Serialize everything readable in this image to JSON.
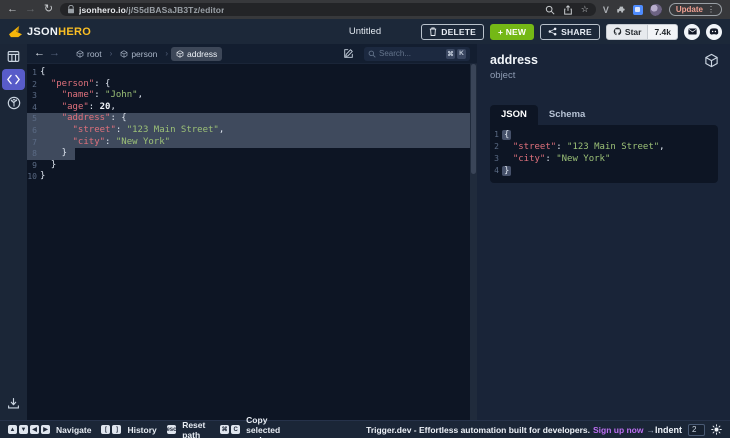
{
  "browser": {
    "url_domain": "jsonhero.io",
    "url_path": "/j/S5dBASaJB3Tz/editor",
    "update_label": "Update"
  },
  "header": {
    "logo_json": "JSON",
    "logo_hero": "HERO",
    "title": "Untitled",
    "delete_label": "DELETE",
    "new_label": "+ NEW",
    "share_label": "SHARE",
    "star_label": "Star",
    "star_count": "7.4k"
  },
  "toolbar": {
    "breadcrumb": [
      {
        "label": "root"
      },
      {
        "label": "person"
      },
      {
        "label": "address"
      }
    ],
    "search_placeholder": "Search...",
    "search_kbd": [
      "⌘",
      "K"
    ]
  },
  "editor": {
    "lines": [
      {
        "n": 1,
        "seg": [
          [
            "{",
            "p"
          ]
        ]
      },
      {
        "n": 2,
        "seg": [
          [
            "  ",
            "p"
          ],
          [
            "\"person\"",
            "k"
          ],
          [
            ": {",
            "p"
          ]
        ]
      },
      {
        "n": 3,
        "seg": [
          [
            "    ",
            "p"
          ],
          [
            "\"name\"",
            "k"
          ],
          [
            ": ",
            "p"
          ],
          [
            "\"John\"",
            "s"
          ],
          [
            ",",
            "p"
          ]
        ]
      },
      {
        "n": 4,
        "seg": [
          [
            "    ",
            "p"
          ],
          [
            "\"age\"",
            "k"
          ],
          [
            ": ",
            "p"
          ],
          [
            "20",
            "n"
          ],
          [
            ",",
            "p"
          ]
        ]
      },
      {
        "n": 5,
        "sel": "full",
        "seg": [
          [
            "    ",
            "p"
          ],
          [
            "\"address\"",
            "k"
          ],
          [
            ": {",
            "p"
          ]
        ]
      },
      {
        "n": 6,
        "sel": "full",
        "seg": [
          [
            "      ",
            "p"
          ],
          [
            "\"street\"",
            "k"
          ],
          [
            ": ",
            "p"
          ],
          [
            "\"123 Main Street\"",
            "s"
          ],
          [
            ",",
            "p"
          ]
        ]
      },
      {
        "n": 7,
        "sel": "full",
        "seg": [
          [
            "      ",
            "p"
          ],
          [
            "\"city\"",
            "k"
          ],
          [
            ": ",
            "p"
          ],
          [
            "\"New York\"",
            "s"
          ]
        ]
      },
      {
        "n": 8,
        "sel": "part",
        "selw": 48,
        "seg": [
          [
            "    }",
            "p"
          ]
        ]
      },
      {
        "n": 9,
        "seg": [
          [
            "  }",
            "p"
          ]
        ]
      },
      {
        "n": 10,
        "seg": [
          [
            "}",
            "p"
          ]
        ]
      }
    ]
  },
  "panel": {
    "title": "address",
    "subtitle": "object",
    "tabs": [
      "JSON",
      "Schema"
    ],
    "active_tab": "JSON",
    "lines": [
      {
        "n": 1,
        "seg": [
          [
            "{",
            "hb"
          ]
        ]
      },
      {
        "n": 2,
        "seg": [
          [
            "  ",
            "p"
          ],
          [
            "\"street\"",
            "k"
          ],
          [
            ": ",
            "p"
          ],
          [
            "\"123 Main Street\"",
            "s"
          ],
          [
            ",",
            "p"
          ]
        ]
      },
      {
        "n": 3,
        "seg": [
          [
            "  ",
            "p"
          ],
          [
            "\"city\"",
            "k"
          ],
          [
            ": ",
            "p"
          ],
          [
            "\"New York\"",
            "s"
          ]
        ]
      },
      {
        "n": 4,
        "seg": [
          [
            "}",
            "hb"
          ]
        ]
      }
    ]
  },
  "statusbar": {
    "items": [
      {
        "keys": [
          "▲",
          "▼",
          "◀",
          "▶"
        ],
        "label": "Navigate"
      },
      {
        "keys": [
          "[",
          "]"
        ],
        "label": "History"
      },
      {
        "keys": [
          "esc"
        ],
        "label": "Reset path"
      },
      {
        "keys": [
          "⌘",
          "C"
        ],
        "label": "Copy selected node"
      }
    ],
    "promo_text": "Trigger.dev - Effortless automation built for developers.",
    "promo_link": "Sign up now",
    "promo_arrow": "→",
    "indent_label": "Indent",
    "indent_value": "2"
  },
  "colors": {
    "accent_indigo": "#585cc9",
    "new_button_green": "#74b816",
    "logo_gold": "#fbbf24",
    "json_key": "#e0717c",
    "json_string": "#9cc177",
    "selection": "#3f4a5d",
    "promo_link_purple": "#bc6ff1"
  }
}
